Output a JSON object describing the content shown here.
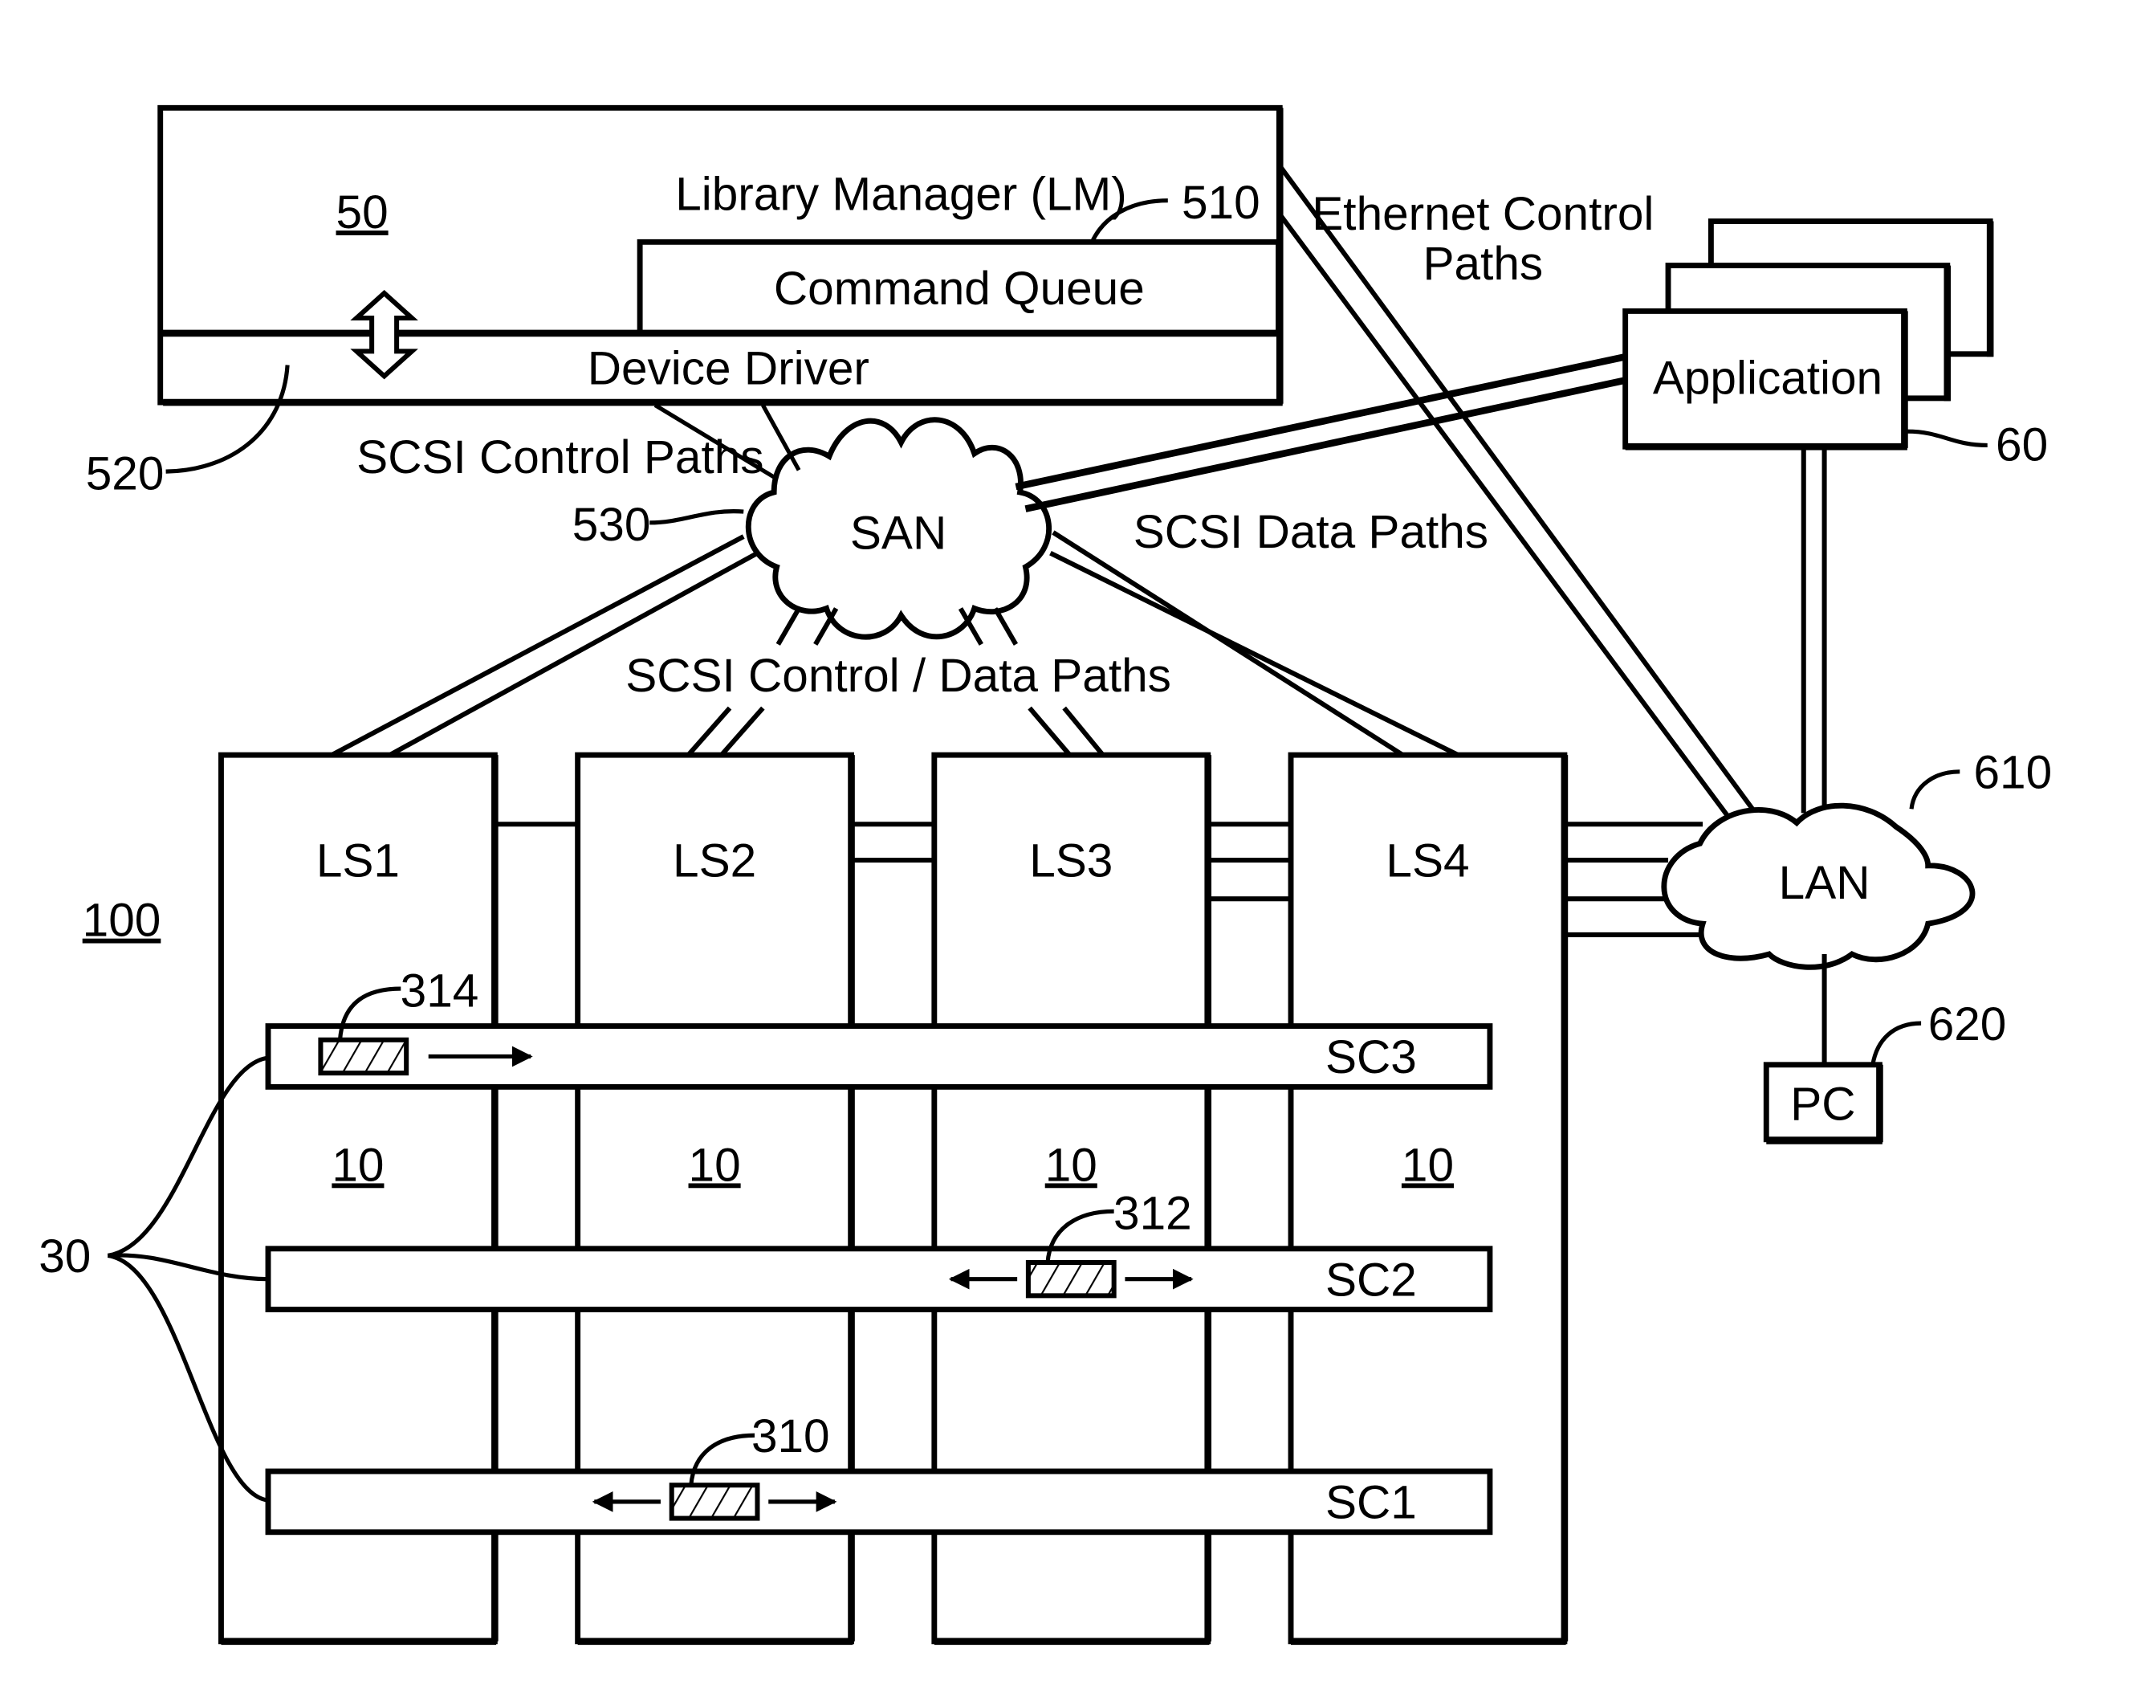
{
  "figure": {
    "host": {
      "ref": "50",
      "title": "Library Manager (LM)",
      "title_ref": "510",
      "command_queue": "Command Queue",
      "device_driver": "Device Driver",
      "device_driver_ref": "520"
    },
    "san": {
      "label": "SAN",
      "ref": "530"
    },
    "lan": {
      "label": "LAN",
      "ref": "610"
    },
    "application": {
      "label": "Application",
      "ref": "60"
    },
    "pc": {
      "label": "PC",
      "ref": "620"
    },
    "path_labels": {
      "scsi_control": "SCSI Control Paths",
      "scsi_data": "SCSI Data Paths",
      "scsi_control_data": "SCSI Control / Data Paths",
      "ethernet_line1": "Ethernet Control",
      "ethernet_line2": "Paths"
    },
    "library": {
      "ref": "100",
      "strings_ref": "30",
      "strings": [
        {
          "name": "LS1",
          "ref": "10"
        },
        {
          "name": "LS2",
          "ref": "10"
        },
        {
          "name": "LS3",
          "ref": "10"
        },
        {
          "name": "LS4",
          "ref": "10"
        }
      ],
      "connectors": [
        {
          "name": "SC3",
          "accessor_ref": "314",
          "accessor_direction": "right"
        },
        {
          "name": "SC2",
          "accessor_ref": "312",
          "accessor_direction": "both"
        },
        {
          "name": "SC1",
          "accessor_ref": "310",
          "accessor_direction": "both"
        }
      ]
    }
  }
}
